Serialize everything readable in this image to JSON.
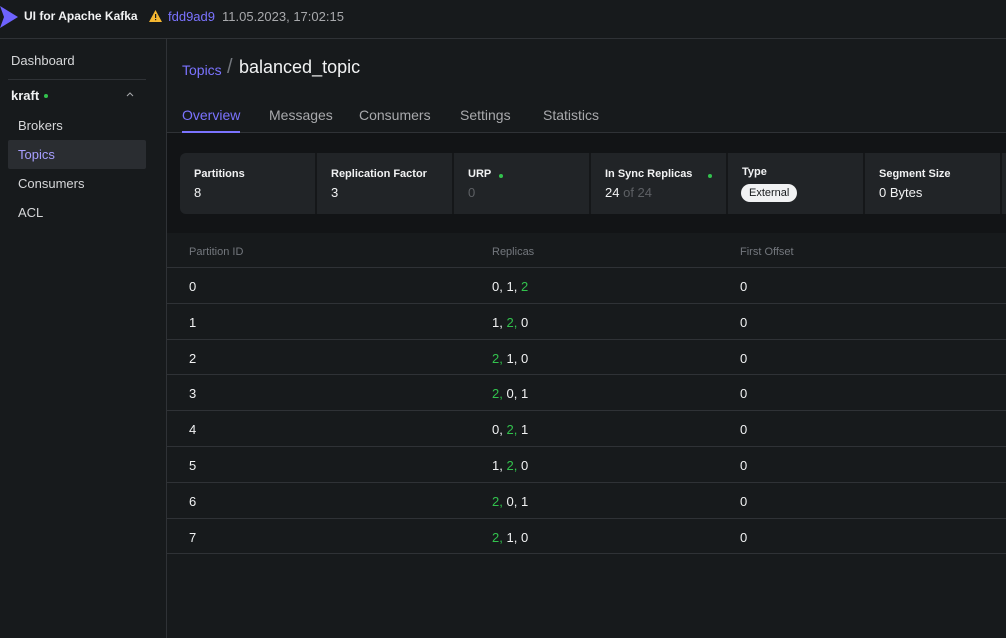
{
  "app": {
    "title": "UI for Apache Kafka",
    "commit": "fdd9ad9",
    "build_date": "11.05.2023, 17:02:15"
  },
  "sidebar": {
    "dashboard": "Dashboard",
    "cluster": "kraft",
    "items": [
      {
        "label": "Brokers",
        "active": false
      },
      {
        "label": "Topics",
        "active": true
      },
      {
        "label": "Consumers",
        "active": false
      },
      {
        "label": "ACL",
        "active": false
      }
    ]
  },
  "breadcrumb": {
    "parent": "Topics",
    "separator": "/",
    "current": "balanced_topic"
  },
  "tabs": [
    {
      "label": "Overview",
      "active": true
    },
    {
      "label": "Messages",
      "active": false
    },
    {
      "label": "Consumers",
      "active": false
    },
    {
      "label": "Settings",
      "active": false
    },
    {
      "label": "Statistics",
      "active": false
    }
  ],
  "stats": {
    "partitions": {
      "label": "Partitions",
      "value": "8"
    },
    "replication_factor": {
      "label": "Replication Factor",
      "value": "3"
    },
    "urp": {
      "label": "URP",
      "value": "0"
    },
    "in_sync": {
      "label": "In Sync Replicas",
      "value": "24",
      "of": "of 24"
    },
    "type": {
      "label": "Type",
      "value": "External"
    },
    "segment_size": {
      "label": "Segment Size",
      "value": "0 Bytes"
    }
  },
  "table": {
    "headers": [
      "Partition ID",
      "Replicas",
      "First Offset"
    ],
    "rows": [
      {
        "id": "0",
        "replicas": [
          {
            "v": "0",
            "g": false
          },
          {
            "v": "1",
            "g": false
          },
          {
            "v": "2",
            "g": true
          }
        ],
        "offset": "0"
      },
      {
        "id": "1",
        "replicas": [
          {
            "v": "1",
            "g": false
          },
          {
            "v": "2",
            "g": true
          },
          {
            "v": "0",
            "g": false
          }
        ],
        "offset": "0"
      },
      {
        "id": "2",
        "replicas": [
          {
            "v": "2",
            "g": true
          },
          {
            "v": "1",
            "g": false
          },
          {
            "v": "0",
            "g": false
          }
        ],
        "offset": "0"
      },
      {
        "id": "3",
        "replicas": [
          {
            "v": "2",
            "g": true
          },
          {
            "v": "0",
            "g": false
          },
          {
            "v": "1",
            "g": false
          }
        ],
        "offset": "0"
      },
      {
        "id": "4",
        "replicas": [
          {
            "v": "0",
            "g": false
          },
          {
            "v": "2",
            "g": true
          },
          {
            "v": "1",
            "g": false
          }
        ],
        "offset": "0"
      },
      {
        "id": "5",
        "replicas": [
          {
            "v": "1",
            "g": false
          },
          {
            "v": "2",
            "g": true
          },
          {
            "v": "0",
            "g": false
          }
        ],
        "offset": "0"
      },
      {
        "id": "6",
        "replicas": [
          {
            "v": "2",
            "g": true
          },
          {
            "v": "0",
            "g": false
          },
          {
            "v": "1",
            "g": false
          }
        ],
        "offset": "0"
      },
      {
        "id": "7",
        "replicas": [
          {
            "v": "2",
            "g": true
          },
          {
            "v": "1",
            "g": false
          },
          {
            "v": "0",
            "g": false
          }
        ],
        "offset": "0"
      }
    ]
  },
  "colors": {
    "accent": "#7b73ff",
    "in_sync_green": "#32c24d",
    "background": "#171a1c"
  }
}
